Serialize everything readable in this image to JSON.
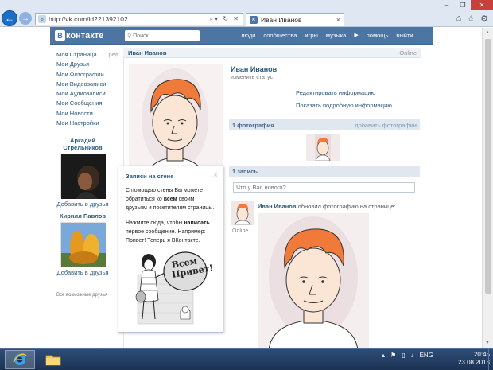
{
  "browser": {
    "url": "http://vk.com/id221392102",
    "tab_title": "Иван Иванов",
    "tab_close": "×",
    "window_controls": [
      "–",
      "❐",
      "✕"
    ],
    "tool_icons": [
      "home-icon",
      "star-icon",
      "gear-icon"
    ]
  },
  "vk": {
    "logo_letter": "В",
    "logo_text": "контакте",
    "search_placeholder": "Поиск",
    "nav": [
      "люди",
      "сообщества",
      "игры",
      "музыка",
      "помощь",
      "выйти"
    ]
  },
  "left_menu": {
    "items": [
      "Моя Страница",
      "Мои Друзья",
      "Мои Фотографии",
      "Мои Видеозаписи",
      "Мои Аудиозаписи",
      "Мои Сообщения",
      "Мои Новости",
      "Мои Настройки"
    ],
    "edit_label": "ред.",
    "friends": [
      {
        "name": "Аркадий Стрельников",
        "add": "Добавить в друзья"
      },
      {
        "name": "Кирилл Павлов",
        "add": "Добавить в друзья"
      }
    ],
    "all_friends": "Все возможные друзья"
  },
  "profile": {
    "header_name": "Иван Иванов",
    "header_status": "Online",
    "name": "Иван Иванов",
    "change_status": "изменить статус",
    "edit_info": "Редактировать информацию",
    "show_info": "Показать подробную информацию",
    "photos_count": "1 фотография",
    "add_photos": "добавить фотографии",
    "wall_count": "1 запись",
    "wall_placeholder": "Что у Вас нового?",
    "post_author": "Иван Иванов",
    "post_action": "обновил фотографию на странице:",
    "post_online": "Online"
  },
  "popup": {
    "title": "Записи на стене",
    "close": "×",
    "p1_before": "С помощью стены Вы можете обратиться ко ",
    "p1_bold": "всем",
    "p1_after": " своим друзьям и посетителям страницы.",
    "p2_before": "Нажмите сюда, чтобы ",
    "p2_bold": "написать",
    "p2_after": " первое сообщение. Например: Привет! Теперь я ВКонтакте.",
    "bubble_line1": "Всем",
    "bubble_line2": "Привет!"
  },
  "taskbar": {
    "lang": "ENG",
    "time": "20:45",
    "date": "23.08.2013"
  },
  "colors": {
    "vk_blue": "#4c75a3",
    "link": "#2b587a",
    "hair": "#f07a3a",
    "skin": "#fbe6d6"
  }
}
